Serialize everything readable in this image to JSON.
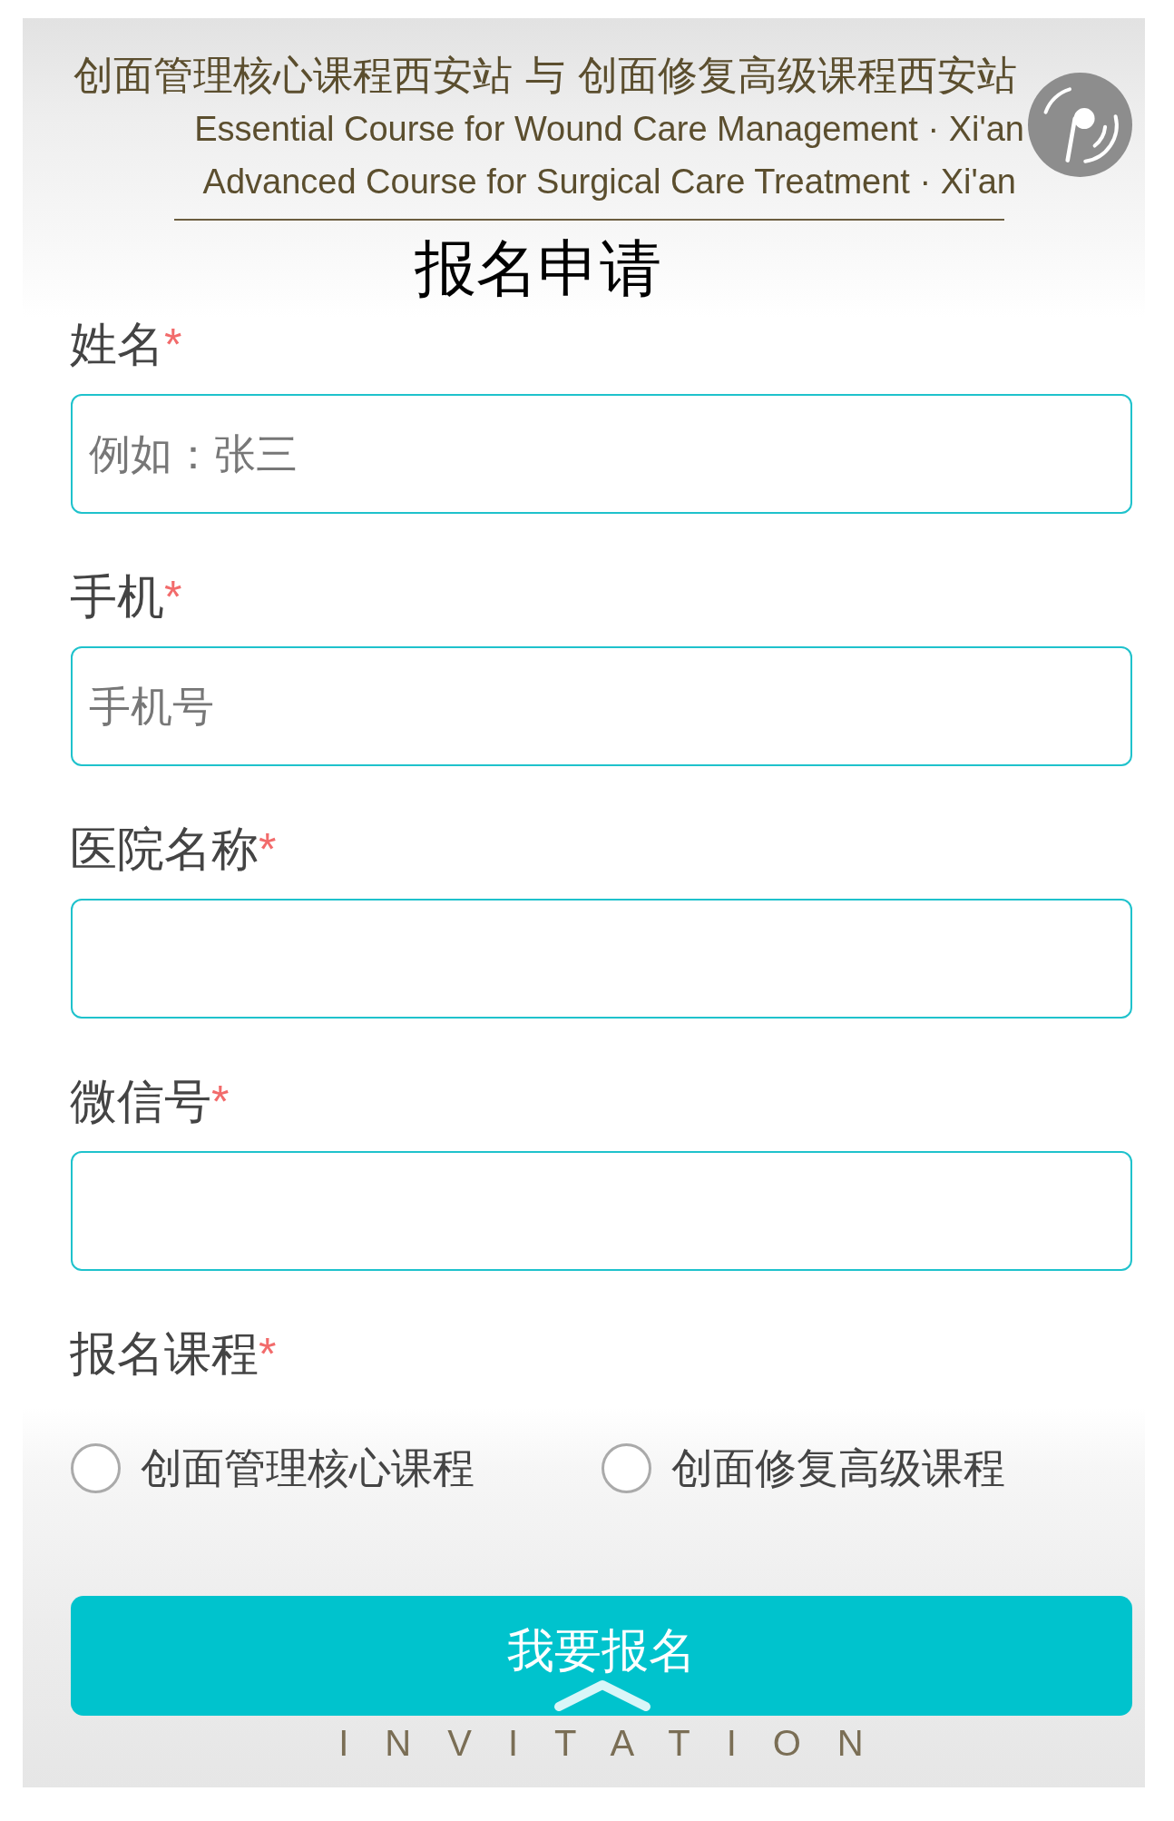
{
  "header": {
    "title": "创面管理核心课程西安站 与 创面修复高级课程西安站",
    "subtitles": [
      "Essential Course for Wound Care Management · Xi'an",
      "Advanced Course for Surgical Care Treatment · Xi'an"
    ]
  },
  "form_title": "报名申请",
  "fields": [
    {
      "label": "姓名",
      "required_mark": "*",
      "placeholder": "例如：张三"
    },
    {
      "label": "手机",
      "required_mark": "*",
      "placeholder": "手机号"
    },
    {
      "label": "医院名称",
      "required_mark": "*"
    },
    {
      "label": "微信号",
      "required_mark": "*"
    }
  ],
  "course": {
    "label": "报名课程",
    "required_mark": "*",
    "options": [
      {
        "label": "创面管理核心课程",
        "selected": false
      },
      {
        "label": "创面修复高级课程",
        "selected": false
      }
    ]
  },
  "submit_button": {
    "label": "我要报名"
  },
  "footer_text": "INVITATION"
}
